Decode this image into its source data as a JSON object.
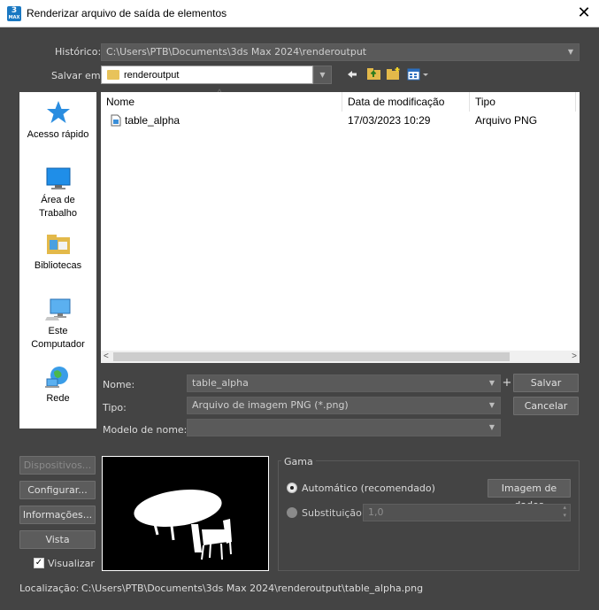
{
  "window": {
    "title": "Renderizar arquivo de saída de elementos",
    "app_icon_text": "3",
    "app_icon_sub": "MAX"
  },
  "historico": {
    "label": "Histórico:",
    "value": "C:\\Users\\PTB\\Documents\\3ds Max 2024\\renderoutput"
  },
  "salvar_em": {
    "label": "Salvar em:",
    "value": "renderoutput"
  },
  "places": [
    {
      "label": "Acesso rápido",
      "icon": "star-icon"
    },
    {
      "label": "Área de Trabalho",
      "icon": "desktop-icon"
    },
    {
      "label": "Bibliotecas",
      "icon": "libraries-icon"
    },
    {
      "label": "Este Computador",
      "icon": "computer-icon"
    },
    {
      "label": "Rede",
      "icon": "network-icon"
    }
  ],
  "file_list": {
    "columns": [
      "Nome",
      "Data de modificação",
      "Tipo"
    ],
    "rows": [
      {
        "name": "table_alpha",
        "date": "17/03/2023 10:29",
        "type": "Arquivo PNG"
      }
    ]
  },
  "nome": {
    "label": "Nome:",
    "value": "table_alpha"
  },
  "tipo": {
    "label": "Tipo:",
    "value": "Arquivo de imagem PNG (*.png)"
  },
  "modelo_de_nome": {
    "label": "Modelo de nome:",
    "value": ""
  },
  "buttons": {
    "plus": "+",
    "salvar": "Salvar",
    "cancelar": "Cancelar",
    "dispositivos": "Dispositivos...",
    "configurar": "Configurar...",
    "informacoes": "Informações...",
    "vista": "Vista"
  },
  "visualizar": {
    "label": "Visualizar",
    "checked": true
  },
  "gama": {
    "title": "Gama",
    "automatico": "Automático (recomendado)",
    "imagem_de_dados": "Imagem de dados",
    "substituicao": "Substituição",
    "override_value": "1,0",
    "selected": "automatico"
  },
  "localizacao": {
    "label": "Localização:",
    "value": "C:\\Users\\PTB\\Documents\\3ds Max 2024\\renderoutput\\table_alpha.png"
  },
  "colors": {
    "dialog_bg": "#444444",
    "field_bg": "#5a5a5a",
    "accent_blue": "#1a78c2"
  }
}
